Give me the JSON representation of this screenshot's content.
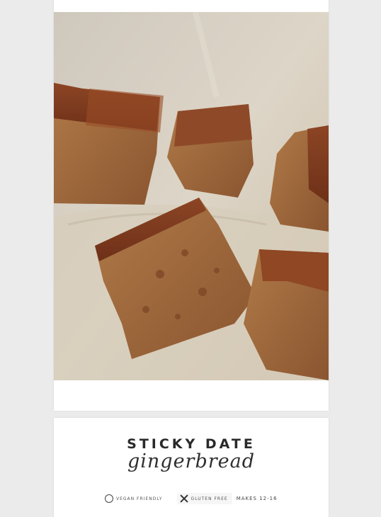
{
  "recipe": {
    "title": "STICKY DATE",
    "subtitle": "gingerbread",
    "badges": {
      "vegan": "VEGAN FRIENDLY",
      "gluten": "GLUTEN FREE",
      "makes": "MAKES 12-16"
    }
  },
  "photo": {
    "icon": "cake-photo",
    "colors": {
      "parchment": "#d2cbc0",
      "cake_crumb": "#a06b3f",
      "cake_crust": "#7a3a1f"
    }
  }
}
